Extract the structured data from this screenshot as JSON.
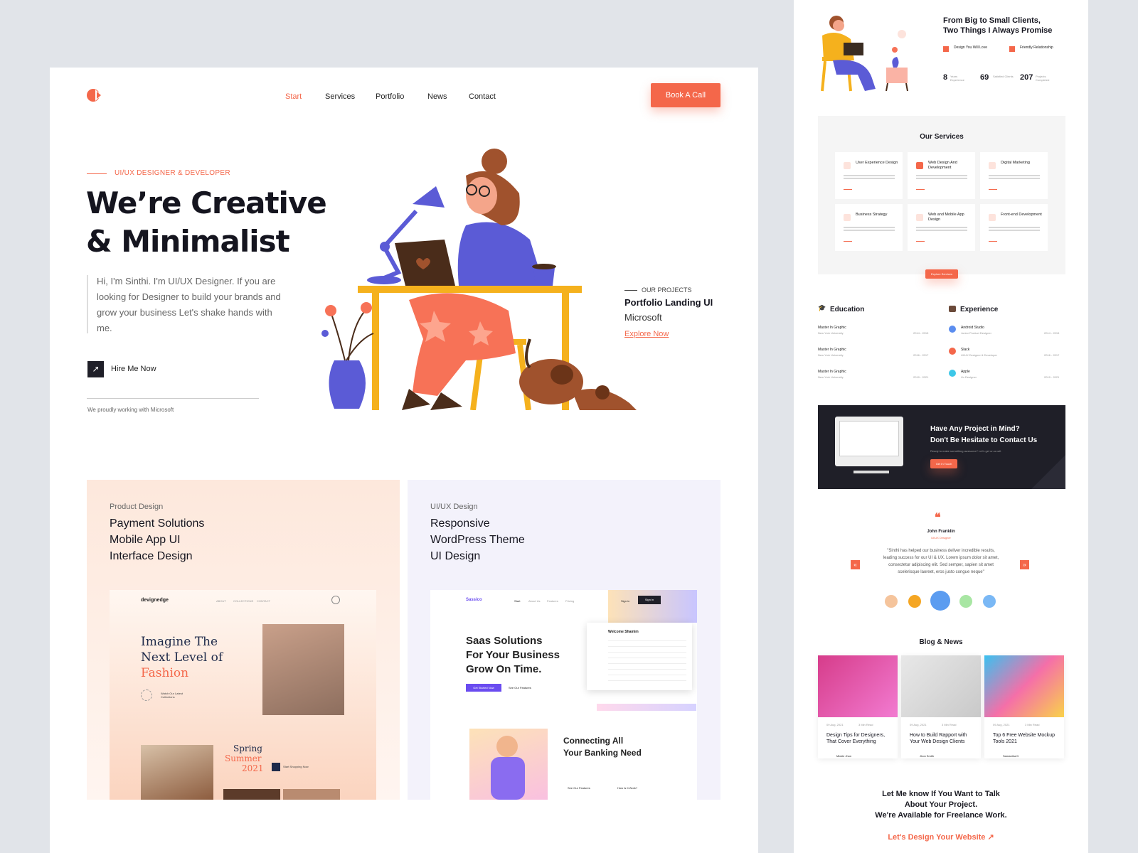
{
  "colors": {
    "accent": "#f4674a",
    "dark": "#1f1f28",
    "lavender": "#f3f2fb",
    "peach": "#fde6da"
  },
  "nav": {
    "items": [
      "Start",
      "Services",
      "Portfolio",
      "News",
      "Contact"
    ],
    "cta": "Book A Call"
  },
  "hero": {
    "eyebrow": "UI/UX DESIGNER & DEVELOPER",
    "title_line1": "We’re Creative",
    "title_line2": "& Minimalist",
    "intro": "Hi, I'm Sinthi. I'm UI/UX Designer. If you are looking for Designer to build your brands and grow your business Let's shake hands with me.",
    "hire": "Hire Me Now",
    "working": "We proudly working with Microsoft"
  },
  "project": {
    "eyebrow": "OUR PROJECTS",
    "title": "Portfolio Landing UI",
    "client": "Microsoft",
    "link": "Explore Now"
  },
  "cards": [
    {
      "category": "Product Design",
      "title": [
        "Payment Solutions",
        "Mobile App UI",
        "Interface Design"
      ],
      "mock": {
        "brand": "devignedge",
        "nav": [
          "ABOUT",
          "COLLECTIONS",
          "CONTACT"
        ],
        "headline1": "Imagine The",
        "headline2": "Next Level of",
        "headline3": "Fashion",
        "watch": "Watch Our Latest Collections",
        "season1": "Spring",
        "season2": "Summer",
        "year": "2021",
        "shop": "Start Shopping Now"
      }
    },
    {
      "category": "UI/UX Design",
      "title": [
        "Responsive",
        "WordPress Theme",
        "UI Design"
      ],
      "mock": {
        "brand": "Sassico",
        "nav": [
          "Start",
          "About Us",
          "Features",
          "Pricing"
        ],
        "signin": "Sign in",
        "signup": "Sign in",
        "headline1": "Saas Solutions",
        "headline2": "For Your Business",
        "headline3": "Grow On Time.",
        "cta1": "Get Started Now",
        "cta2": "See Our Features",
        "welcome": "Welcome Shamim",
        "banking1": "Connecting All",
        "banking2": "Your Banking Need",
        "cta3": "See Our Features",
        "cta4": "How Is It Work?"
      }
    }
  ],
  "side": {
    "promise": {
      "title1": "From Big to Small Clients,",
      "title2": "Two Things I Always Promise",
      "item1": "Design You Will Love",
      "item2": "Friendly Relationship",
      "stats": [
        {
          "n": "8",
          "l": "Years Experience"
        },
        {
          "n": "69",
          "l": "Satisfied Clients"
        },
        {
          "n": "207",
          "l": "Projects Completed"
        }
      ]
    },
    "services": {
      "title": "Our Services",
      "items": [
        "User Experience Design",
        "Web Design And Development",
        "Digital Marketing",
        "Business Strategy",
        "Web and Mobile App Design",
        "Front-end Development"
      ],
      "button": "Explore Services"
    },
    "education": {
      "title": "Education",
      "items": [
        {
          "t": "Master In Graphic",
          "s": "New York University",
          "y": "2014 - 2015"
        },
        {
          "t": "Master In Graphic",
          "s": "New York University",
          "y": "2016 - 2017"
        },
        {
          "t": "Master In Graphic",
          "s": "New York University",
          "y": "2019 - 2021"
        }
      ]
    },
    "experience": {
      "title": "Experience",
      "items": [
        {
          "t": "Android Studio",
          "s": "Junior Product Designer",
          "y": "2014 - 2015"
        },
        {
          "t": "Slack",
          "s": "UI/UX Designer & Developer",
          "y": "2016 - 2017"
        },
        {
          "t": "Apple",
          "s": "Ux Designer",
          "y": "2019 - 2021"
        }
      ]
    },
    "contact": {
      "title1": "Have Any Project in Mind?",
      "title2": "Don't Be Hesitate to Contact Us",
      "sub": "Ready to make something awesome? Let's get on a call.",
      "button": "Get In Touch"
    },
    "testimonial": {
      "name": "John Franklin",
      "role": "UI/UX Designer",
      "quote": "\"Sinthi has helped our business deliver incredible results, leading success for our UI & UX. Lorem ipsum dolor sit amet, consectetur adipiscing elit. Sed semper, sapien sit amet scelerisque laoreet, eros justo congue neque\""
    },
    "blog": {
      "title": "Blog & News",
      "posts": [
        {
          "date": "09 Aug, 2021",
          "read": "3 Min Read",
          "title": "Design Tips for Designers, That Cover Everything",
          "author": "Mickle Jhon"
        },
        {
          "date": "09 Aug, 2021",
          "read": "3 Min Read",
          "title": "How to Build Rapport with Your Web Design Clients",
          "author": "Jhon Smith"
        },
        {
          "date": "09 Aug, 2021",
          "read": "3 Min Read",
          "title": "Top 6 Free Website Mockup Tools 2021",
          "author": "Samantha D"
        }
      ]
    },
    "footer": {
      "line1": "Let Me know If You Want to Talk",
      "line2": "About Your Project.",
      "line3": "We're Available for Freelance Work.",
      "link": "Let's Design Your Website ↗"
    }
  }
}
